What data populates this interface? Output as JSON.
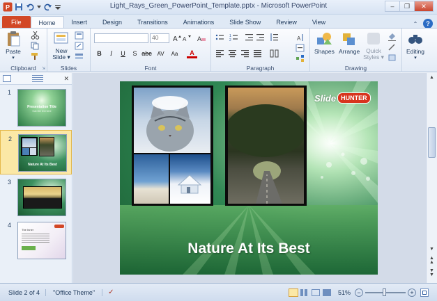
{
  "window": {
    "title": "Light_Rays_Green_PowerPoint_Template.pptx - Microsoft PowerPoint",
    "minimize": "–",
    "restore": "❐",
    "close": "✕"
  },
  "tabs": [
    {
      "label": "File"
    },
    {
      "label": "Home"
    },
    {
      "label": "Insert"
    },
    {
      "label": "Design"
    },
    {
      "label": "Transitions"
    },
    {
      "label": "Animations"
    },
    {
      "label": "Slide Show"
    },
    {
      "label": "Review"
    },
    {
      "label": "View"
    }
  ],
  "ribbon": {
    "clipboard": {
      "label": "Clipboard",
      "paste": "Paste"
    },
    "slides": {
      "label": "Slides",
      "new_slide": "New Slide ▾"
    },
    "font": {
      "label": "Font",
      "size": "40"
    },
    "paragraph": {
      "label": "Paragraph"
    },
    "drawing": {
      "label": "Drawing",
      "shapes": "Shapes",
      "arrange": "Arrange",
      "quick_styles": "Quick Styles ▾"
    },
    "editing": {
      "label": "Editing"
    }
  },
  "thumbnails": [
    {
      "number": "1",
      "title": "Presentation Title",
      "subtitle": "Sub title text here"
    },
    {
      "number": "2",
      "title": "Nature At Its Best"
    },
    {
      "number": "3"
    },
    {
      "number": "4",
      "title": "The Inner"
    }
  ],
  "slide": {
    "title": "Nature At Its Best",
    "brand": {
      "slide": "Slide",
      "hunter": "HUNTER"
    }
  },
  "status": {
    "slide_info": "Slide 2 of 4",
    "theme": "\"Office Theme\"",
    "zoom": "51%",
    "zoom_minus": "−",
    "zoom_plus": "+"
  },
  "colors": {
    "file_tab": "#d24726",
    "slide_green": "#2f8a55",
    "selected_thumb": "#f9d55b"
  }
}
